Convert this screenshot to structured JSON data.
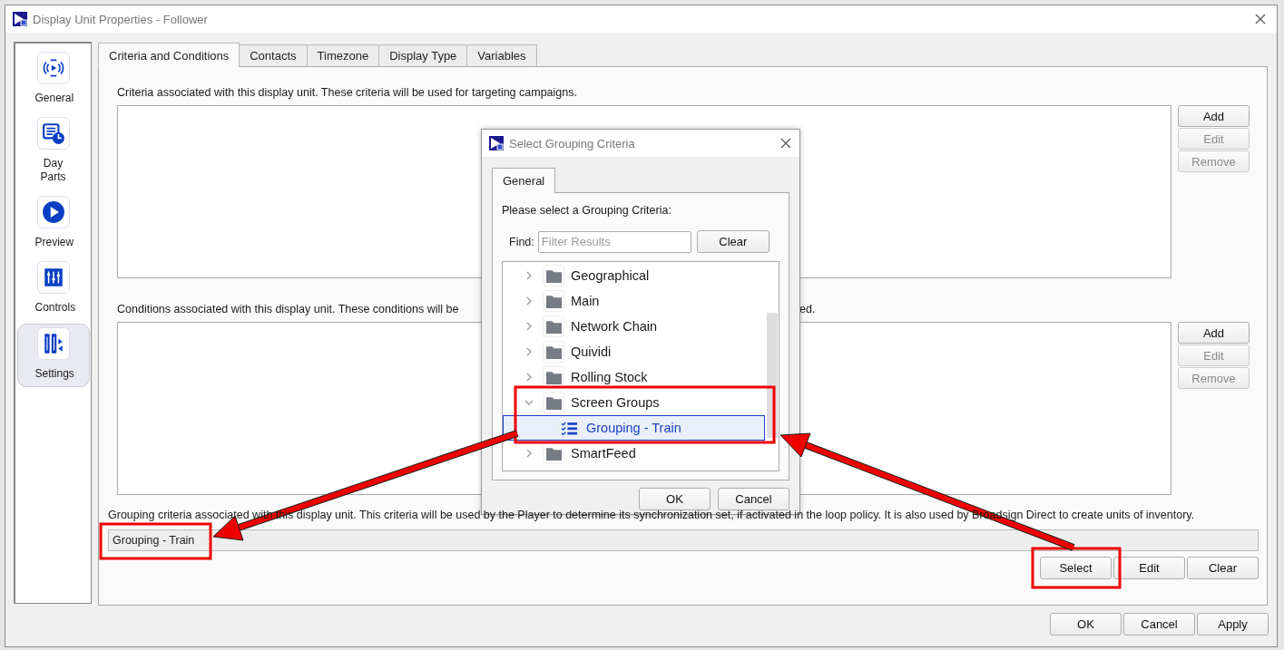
{
  "window": {
    "title": "Display Unit Properties - Follower"
  },
  "sidebar": {
    "items": [
      {
        "label": "General",
        "kind": "broadcast",
        "selected": false
      },
      {
        "label": "Day Parts",
        "kind": "calendar",
        "selected": false
      },
      {
        "label": "Preview",
        "kind": "play",
        "selected": false
      },
      {
        "label": "Controls",
        "kind": "sliders",
        "selected": false
      },
      {
        "label": "Settings",
        "kind": "settings",
        "selected": true
      }
    ]
  },
  "tabs": [
    {
      "label": "Criteria and Conditions",
      "selected": true
    },
    {
      "label": "Contacts",
      "selected": false
    },
    {
      "label": "Timezone",
      "selected": false
    },
    {
      "label": "Display Type",
      "selected": false
    },
    {
      "label": "Variables",
      "selected": false
    }
  ],
  "criteria": {
    "description": "Criteria associated with this display unit. These criteria will be used for targeting campaigns.",
    "buttons": [
      {
        "label": "Add",
        "disabled": false
      },
      {
        "label": "Edit",
        "disabled": true
      },
      {
        "label": "Remove",
        "disabled": true
      }
    ]
  },
  "conditions": {
    "description": "Conditions associated with this display unit. These conditions will be",
    "description_end": "ed.",
    "buttons": [
      {
        "label": "Add",
        "disabled": false
      },
      {
        "label": "Edit",
        "disabled": true
      },
      {
        "label": "Remove",
        "disabled": true
      }
    ]
  },
  "grouping": {
    "description": "Grouping criteria associated with this display unit. This criteria will be used by the Player to determine its synchronization set, if activated in the loop policy. It is also used by Broadsign Direct to create units of inventory.",
    "value": "Grouping - Train",
    "buttons": [
      "Select",
      "Edit",
      "Clear"
    ]
  },
  "footer_buttons": [
    "OK",
    "Cancel",
    "Apply"
  ],
  "dialog": {
    "title": "Select Grouping Criteria",
    "tabs": [
      {
        "label": "General",
        "selected": true
      }
    ],
    "prompt": "Please select a Grouping Criteria:",
    "find_label": "Find:",
    "find_placeholder": "Filter Results",
    "clear_button": "Clear",
    "tree": [
      {
        "label": "Geographical",
        "expanded": false,
        "selected": false
      },
      {
        "label": "Main",
        "expanded": false,
        "selected": false
      },
      {
        "label": "Network Chain",
        "expanded": false,
        "selected": false
      },
      {
        "label": "Quividi",
        "expanded": false,
        "selected": false
      },
      {
        "label": "Rolling Stock",
        "expanded": false,
        "selected": false
      },
      {
        "label": "Screen Groups",
        "expanded": true,
        "selected": false,
        "children": [
          {
            "label": "Grouping - Train",
            "selected": true
          }
        ]
      },
      {
        "label": "SmartFeed",
        "expanded": false,
        "selected": false
      }
    ],
    "buttons": [
      "OK",
      "Cancel"
    ]
  }
}
